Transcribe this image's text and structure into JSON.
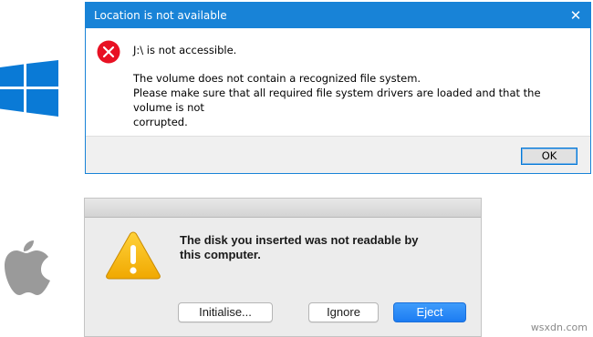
{
  "windows": {
    "logo": "windows-logo",
    "title": "Location is not available",
    "close_glyph": "✕",
    "heading": "J:\\ is not accessible.",
    "message_lines": [
      "The volume does not contain a recognized file system.",
      "Please make sure that all required file system drivers are loaded and that the volume is not",
      "corrupted."
    ],
    "ok_label": "OK",
    "icon": "error-icon",
    "colors": {
      "titlebar": "#1883d7",
      "error_icon": "#e81123"
    }
  },
  "mac": {
    "logo": "apple-logo",
    "icon": "warning-icon",
    "message_lines": [
      "The disk you inserted was not readable by",
      "this computer."
    ],
    "buttons": {
      "initialise": "Initialise...",
      "ignore": "Ignore",
      "eject": "Eject"
    },
    "colors": {
      "default_button": "#1c7cf2",
      "warning_icon": "#f5b400"
    }
  },
  "watermark": "wsxdn.com"
}
